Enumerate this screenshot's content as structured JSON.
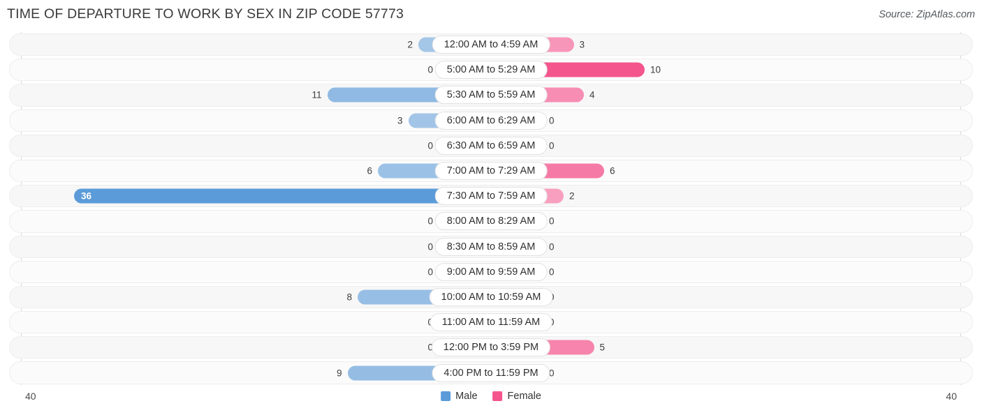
{
  "header": {
    "title": "TIME OF DEPARTURE TO WORK BY SEX IN ZIP CODE 57773",
    "source": "Source: ZipAtlas.com"
  },
  "axis": {
    "left_tick": "40",
    "right_tick": "40",
    "max": 40
  },
  "legend": {
    "items": [
      {
        "label": "Male",
        "color": "#5b9bd9"
      },
      {
        "label": "Female",
        "color": "#f4558c"
      }
    ]
  },
  "colors": {
    "male_min": "#a8c8e8",
    "male_max": "#5b9bd9",
    "female_min": "#f9b2cc",
    "female_max": "#f4558c",
    "track": "#f7f7f7",
    "pill_bg": "#ffffff"
  },
  "chart_data": {
    "type": "bar",
    "title": "TIME OF DEPARTURE TO WORK BY SEX IN ZIP CODE 57773",
    "subtitle": "",
    "xlabel": "",
    "ylabel": "",
    "orientation": "horizontal-diverging",
    "xlim": [
      0,
      40
    ],
    "grid": false,
    "legend_position": "bottom-center",
    "categories": [
      "12:00 AM to 4:59 AM",
      "5:00 AM to 5:29 AM",
      "5:30 AM to 5:59 AM",
      "6:00 AM to 6:29 AM",
      "6:30 AM to 6:59 AM",
      "7:00 AM to 7:29 AM",
      "7:30 AM to 7:59 AM",
      "8:00 AM to 8:29 AM",
      "8:30 AM to 8:59 AM",
      "9:00 AM to 9:59 AM",
      "10:00 AM to 10:59 AM",
      "11:00 AM to 11:59 AM",
      "12:00 PM to 3:59 PM",
      "4:00 PM to 11:59 PM"
    ],
    "series": [
      {
        "name": "Male",
        "color": "#5b9bd9",
        "values": [
          2,
          0,
          11,
          3,
          0,
          6,
          36,
          0,
          0,
          0,
          8,
          0,
          0,
          9
        ]
      },
      {
        "name": "Female",
        "color": "#f4558c",
        "values": [
          3,
          10,
          4,
          0,
          0,
          6,
          2,
          0,
          0,
          0,
          0,
          0,
          5,
          0
        ]
      }
    ]
  }
}
